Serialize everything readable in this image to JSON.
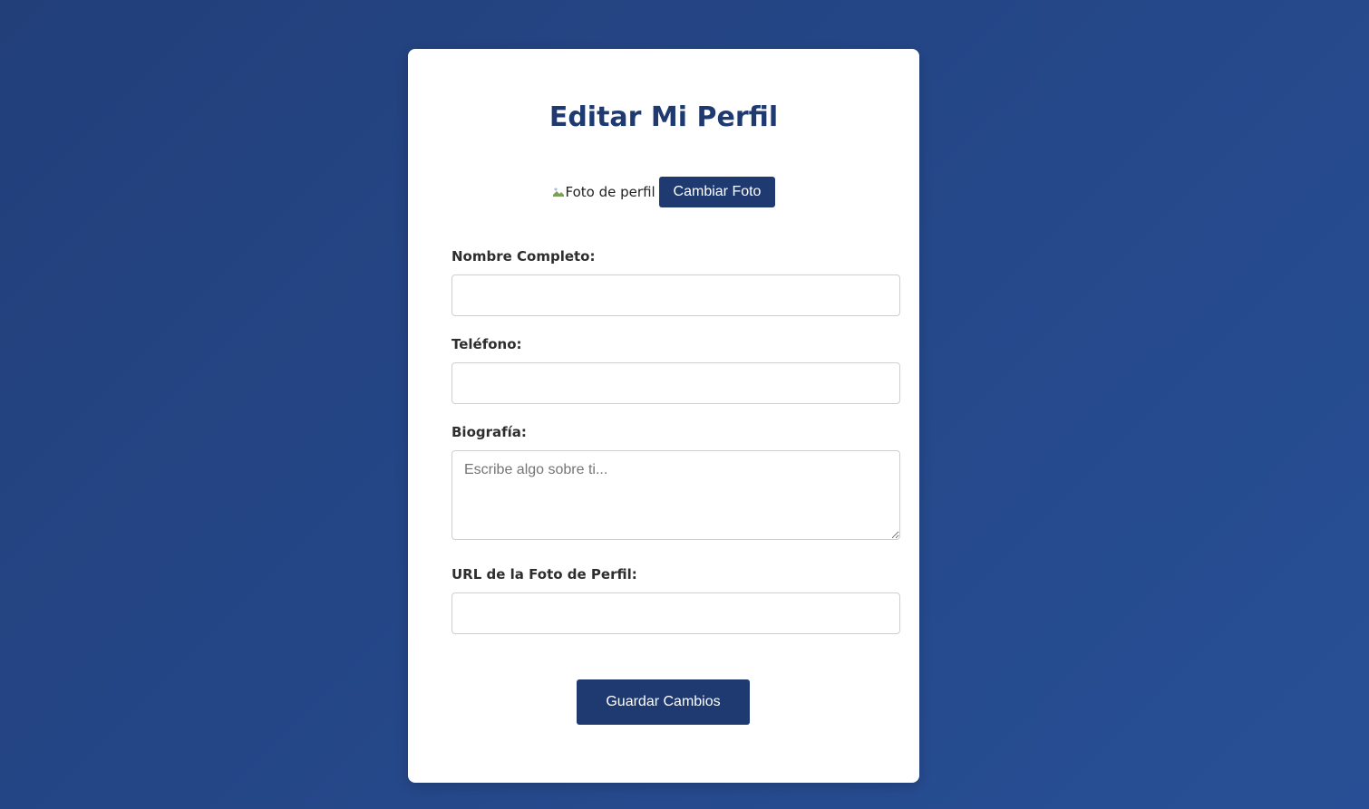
{
  "page": {
    "title": "Editar Mi Perfil"
  },
  "photo": {
    "alt_text": "Foto de perfil",
    "change_button_label": "Cambiar Foto"
  },
  "form": {
    "fields": [
      {
        "label": "Nombre Completo:",
        "value": "",
        "placeholder": ""
      },
      {
        "label": "Teléfono:",
        "value": "",
        "placeholder": ""
      },
      {
        "label": "Biografía:",
        "value": "",
        "placeholder": "Escribe algo sobre ti..."
      },
      {
        "label": "URL de la Foto de Perfil:",
        "value": "",
        "placeholder": ""
      }
    ],
    "submit_label": "Guardar Cambios"
  },
  "colors": {
    "background_start": "#223f7a",
    "background_end": "#284f95",
    "primary": "#1e3a70",
    "card": "#ffffff"
  },
  "icons": {
    "broken_image": "broken-image-icon"
  }
}
